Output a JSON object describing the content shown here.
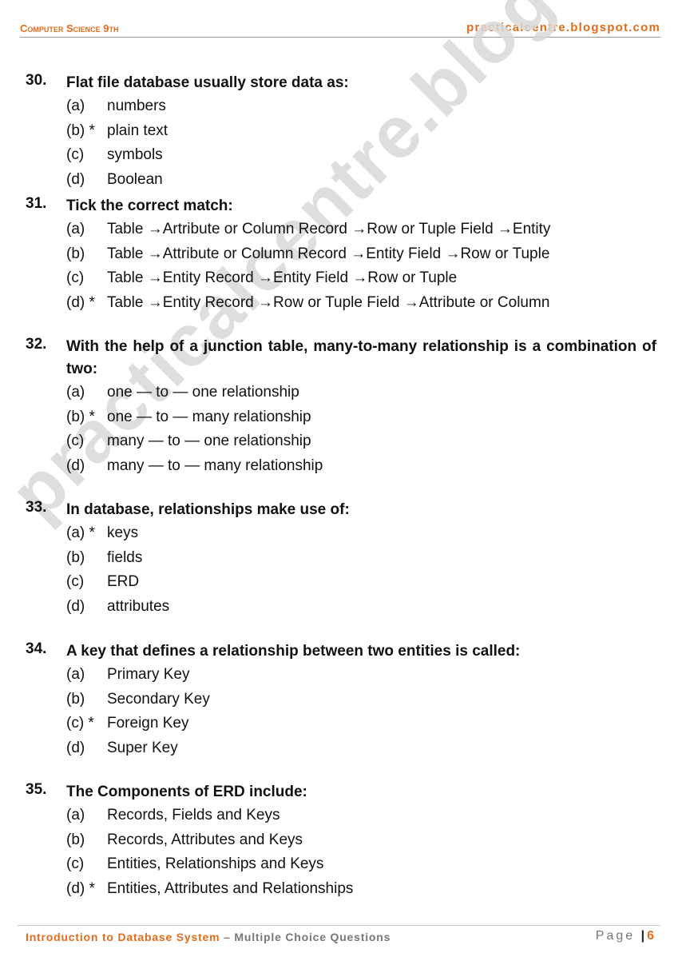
{
  "header": {
    "left_title": "Computer Science 9th",
    "right_site": "practicalcentre.blogspot.com"
  },
  "watermark": "practicalcentre.blogspot.com",
  "questions": [
    {
      "number": "30.",
      "text": "Flat file database usually store data as:",
      "options": [
        {
          "label": "(a)",
          "text": "numbers"
        },
        {
          "label": "(b) *",
          "text": "plain text"
        },
        {
          "label": "(c)",
          "text": "symbols"
        },
        {
          "label": "(d)",
          "text": "Boolean"
        }
      ]
    },
    {
      "number": "31.",
      "text": "Tick the correct match:",
      "options": [
        {
          "label": "(a)",
          "text": "Table →Artribute or Column Record →Row or Tuple Field →Entity"
        },
        {
          "label": "(b)",
          "text": "Table →Attribute or Column Record →Entity Field →Row or Tuple"
        },
        {
          "label": "(c)",
          "text": "Table →Entity Record →Entity Field →Row or Tuple"
        },
        {
          "label": "(d) *",
          "text": "Table →Entity Record →Row or Tuple Field →Attribute or Column"
        }
      ]
    },
    {
      "number": "32.",
      "text": "With the help of a junction table, many-to-many relationship is a combination of two:",
      "options": [
        {
          "label": "(a)",
          "text": "one — to — one relationship"
        },
        {
          "label": "(b) *",
          "text": "one — to — many relationship"
        },
        {
          "label": "(c)",
          "text": "many — to — one relationship"
        },
        {
          "label": "(d)",
          "text": "many — to — many relationship"
        }
      ]
    },
    {
      "number": "33.",
      "text": "In database, relationships make use of:",
      "options": [
        {
          "label": "(a) *",
          "text": "keys"
        },
        {
          "label": "(b)",
          "text": "fields"
        },
        {
          "label": "(c)",
          "text": "ERD"
        },
        {
          "label": "(d)",
          "text": "attributes"
        }
      ]
    },
    {
      "number": "34.",
      "text": "A key that defines a relationship between two entities is called:",
      "options": [
        {
          "label": "(a)",
          "text": "Primary Key"
        },
        {
          "label": "(b)",
          "text": "Secondary Key"
        },
        {
          "label": "(c) *",
          "text": "Foreign Key"
        },
        {
          "label": "(d)",
          "text": "Super Key"
        }
      ]
    },
    {
      "number": "35.",
      "text": "The Components of ERD include:",
      "options": [
        {
          "label": "(a)",
          "text": "Records, Fields and Keys"
        },
        {
          "label": "(b)",
          "text": "Records, Attributes and Keys"
        },
        {
          "label": "(c)",
          "text": "Entities, Relationships and Keys"
        },
        {
          "label": "(d) *",
          "text": "Entities, Attributes and Relationships"
        }
      ]
    }
  ],
  "footer": {
    "chapter": "Introduction to Database System",
    "separator": " – ",
    "section": "Multiple Choice Questions",
    "page_label": "Page",
    "page_sep": "|",
    "page_number": "6"
  }
}
